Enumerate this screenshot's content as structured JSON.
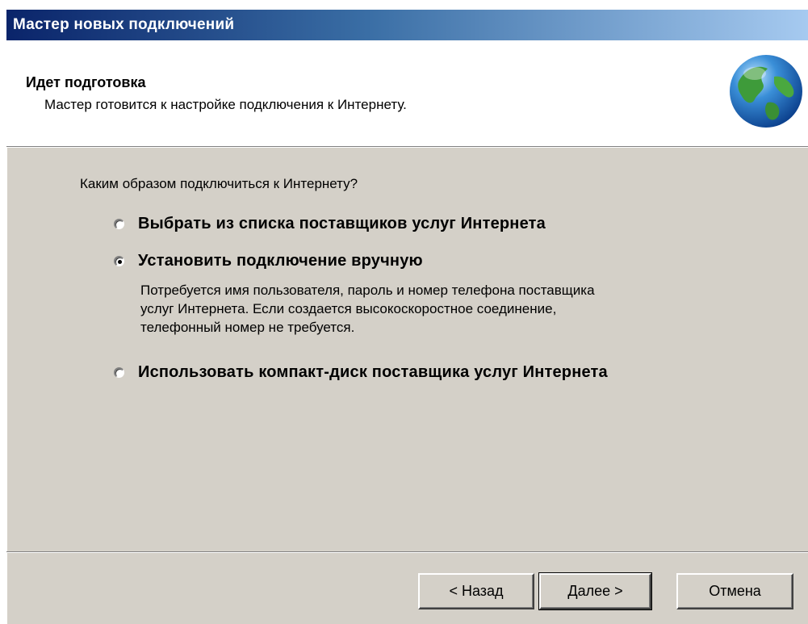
{
  "window": {
    "title": "Мастер новых подключений"
  },
  "header": {
    "title": "Идет подготовка",
    "subtitle": "Мастер готовится к настройке подключения к Интернету.",
    "icon": "globe-icon"
  },
  "main": {
    "question": "Каким образом подключиться к Интернету?",
    "options": [
      {
        "label": "Выбрать из списка поставщиков услуг Интернета",
        "checked": false
      },
      {
        "label": "Установить подключение вручную",
        "checked": true
      },
      {
        "label": "Использовать компакт-диск поставщика услуг Интернета",
        "checked": false
      }
    ],
    "manual_description": [
      "Потребуется имя пользователя, пароль и  номер телефона поставщика",
      "услуг Интернета. Если создается высокоскоростное соединение,",
      "телефонный номер не требуется."
    ]
  },
  "buttons": {
    "back": "< Назад",
    "next": "Далее >",
    "cancel": "Отмена"
  }
}
